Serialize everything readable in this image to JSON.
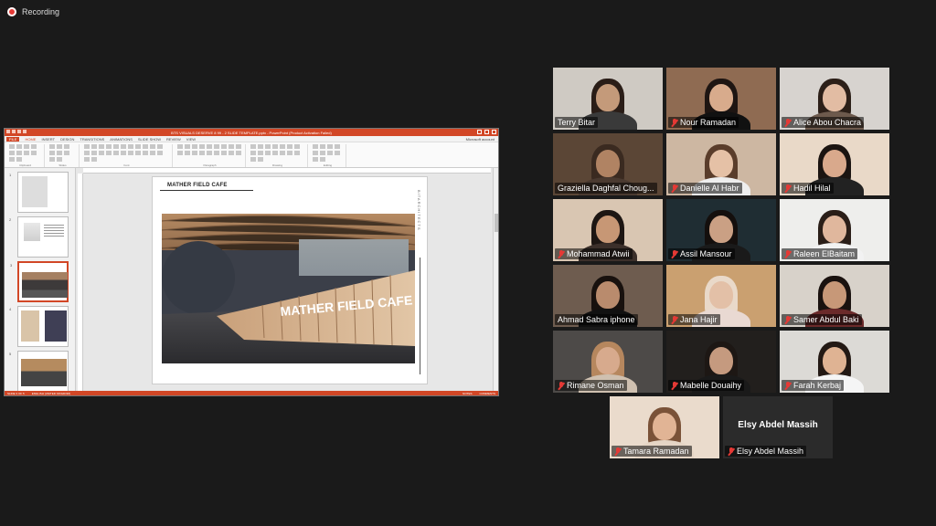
{
  "recording": {
    "label": "Recording"
  },
  "ppt": {
    "title": "BTS VISUALS DESERVE 8 99 - 2 SLIDE TEMPLATE.pptx - PowerPoint (Product Activation Failed)",
    "tabs": [
      "FILE",
      "HOME",
      "INSERT",
      "DESIGN",
      "TRANSITIONS",
      "ANIMATIONS",
      "SLIDE SHOW",
      "REVIEW",
      "VIEW"
    ],
    "active_tab": "HOME",
    "account": "Microsoft account",
    "ribbon_groups": [
      "Clipboard",
      "Slides",
      "Font",
      "Paragraph",
      "Drawing",
      "Editing"
    ],
    "slide_numbers": [
      "1",
      "2",
      "3",
      "4",
      "5"
    ],
    "slide_title": "MATHER FIELD CAFE",
    "brand_vertical": "BITARCHITECTS",
    "render_sign": "MATHER FIELD CAFE",
    "status": {
      "slide": "SLIDE 3 OF 5",
      "lang": "ENGLISH (UNITED KINGDOM)",
      "notes": "NOTES",
      "comments": "COMMENTS"
    },
    "colors": {
      "accent": "#d24726"
    }
  },
  "participants": [
    {
      "name": "Terry Bitar",
      "muted": false,
      "skin": "#c49a7a",
      "hair": "#2a1d17",
      "shirt": "#3a3a3a",
      "bg": "#cfcac3"
    },
    {
      "name": "Nour Ramadan",
      "muted": true,
      "skin": "#d8ab8c",
      "hair": "#1e1512",
      "shirt": "#111",
      "bg": "#8f6b52"
    },
    {
      "name": "Alice Abou Chacra",
      "muted": true,
      "skin": "#e2bca3",
      "hair": "#2c1f18",
      "shirt": "#6d5a4d",
      "bg": "#d7d3cf"
    },
    {
      "name": "Graziella Daghfal Choug...",
      "muted": false,
      "skin": "#b08363",
      "hair": "#3a2a20",
      "shirt": "#4a3a30",
      "bg": "#5b4636"
    },
    {
      "name": "Danielle Al Habr",
      "muted": true,
      "skin": "#e5c1a6",
      "hair": "#5a3d2b",
      "shirt": "#eeeeee",
      "bg": "#cdb7a2"
    },
    {
      "name": "Hadil Hilal",
      "muted": true,
      "skin": "#d9a98c",
      "hair": "#1b1411",
      "shirt": "#222",
      "bg": "#e9d9c8"
    },
    {
      "name": "Mohammad Atwii",
      "muted": true,
      "skin": "#c79775",
      "hair": "#1d1613",
      "shirt": "#3b2f2a",
      "bg": "#d9c6b2"
    },
    {
      "name": "Assil Mansour",
      "muted": true,
      "skin": "#caa084",
      "hair": "#140f0d",
      "shirt": "#1a1a1a",
      "bg": "#1f2d33"
    },
    {
      "name": "Raleen ElBaitam",
      "muted": true,
      "skin": "#e0b79d",
      "hair": "#2a1e18",
      "shirt": "#f2f2f2",
      "bg": "#eeeeec"
    },
    {
      "name": "Ahmad Sabra iphone",
      "muted": false,
      "skin": "#b98b6d",
      "hair": "#18110e",
      "shirt": "#111",
      "bg": "#6e5c4f"
    },
    {
      "name": "Jana Hajir",
      "muted": true,
      "skin": "#e3c0a7",
      "hair": "#e9d9c9",
      "shirt": "#e9d9d2",
      "bg": "#caa070"
    },
    {
      "name": "Samer Abdul Baki",
      "muted": true,
      "skin": "#c79878",
      "hair": "#1a120f",
      "shirt": "#6b2a2a",
      "bg": "#d8d2ca"
    },
    {
      "name": "Rimane Osman",
      "muted": true,
      "skin": "#d7aa8d",
      "hair": "#b6875e",
      "shirt": "#cfc0b0",
      "bg": "#4d4a48"
    },
    {
      "name": "Mabelle Douaihy",
      "muted": true,
      "skin": "#c59a7f",
      "hair": "#1d1714",
      "shirt": "#1a1a1a",
      "bg": "#221f1d"
    },
    {
      "name": "Farah Kerbaj",
      "muted": true,
      "skin": "#dfb393",
      "hair": "#231914",
      "shirt": "#f5f5f5",
      "bg": "#dcdad6"
    },
    {
      "name": "Tamara Ramadan",
      "muted": true,
      "skin": "#e1b495",
      "hair": "#7a5238",
      "shirt": "#e5d5c5",
      "bg": "#eadbcc"
    },
    {
      "name": "Elsy Abdel Massih",
      "muted": true,
      "video": false
    }
  ]
}
